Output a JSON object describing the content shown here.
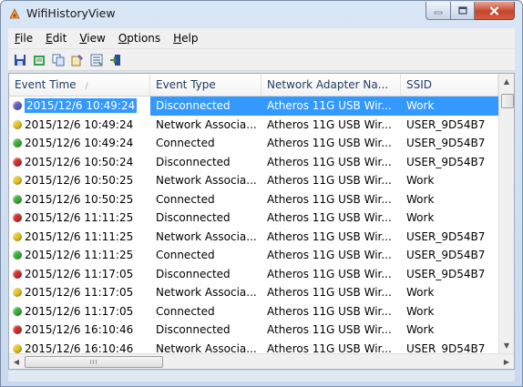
{
  "window": {
    "title": "WifiHistoryView"
  },
  "menu": [
    {
      "label": "File",
      "u": "F",
      "rest": "ile"
    },
    {
      "label": "Edit",
      "u": "E",
      "rest": "dit"
    },
    {
      "label": "View",
      "u": "V",
      "rest": "iew"
    },
    {
      "label": "Options",
      "u": "O",
      "rest": "ptions"
    },
    {
      "label": "Help",
      "u": "H",
      "rest": "elp"
    }
  ],
  "toolbar": {
    "icons": [
      "save-icon",
      "html-report-icon",
      "copy-icon",
      "properties-icon",
      "options-icon",
      "exit-icon"
    ]
  },
  "columns": [
    "Event Time",
    "Event Type",
    "Network Adapter Na...",
    "SSID"
  ],
  "rows": [
    {
      "status": "blue",
      "time": "2015/12/6 10:49:24",
      "type": "Disconnected",
      "adapter": "Atheros 11G USB Wir...",
      "ssid": "Work"
    },
    {
      "status": "yellow",
      "time": "2015/12/6 10:49:24",
      "type": "Network Associa...",
      "adapter": "Atheros 11G USB Wir...",
      "ssid": "USER_9D54B7"
    },
    {
      "status": "green",
      "time": "2015/12/6 10:49:24",
      "type": "Connected",
      "adapter": "Atheros 11G USB Wir...",
      "ssid": "USER_9D54B7"
    },
    {
      "status": "red",
      "time": "2015/12/6 10:50:24",
      "type": "Disconnected",
      "adapter": "Atheros 11G USB Wir...",
      "ssid": "USER_9D54B7"
    },
    {
      "status": "yellow",
      "time": "2015/12/6 10:50:25",
      "type": "Network Associa...",
      "adapter": "Atheros 11G USB Wir...",
      "ssid": "Work"
    },
    {
      "status": "green",
      "time": "2015/12/6 10:50:25",
      "type": "Connected",
      "adapter": "Atheros 11G USB Wir...",
      "ssid": "Work"
    },
    {
      "status": "red",
      "time": "2015/12/6 11:11:25",
      "type": "Disconnected",
      "adapter": "Atheros 11G USB Wir...",
      "ssid": "Work"
    },
    {
      "status": "yellow",
      "time": "2015/12/6 11:11:25",
      "type": "Network Associa...",
      "adapter": "Atheros 11G USB Wir...",
      "ssid": "USER_9D54B7"
    },
    {
      "status": "green",
      "time": "2015/12/6 11:11:25",
      "type": "Connected",
      "adapter": "Atheros 11G USB Wir...",
      "ssid": "USER_9D54B7"
    },
    {
      "status": "red",
      "time": "2015/12/6 11:17:05",
      "type": "Disconnected",
      "adapter": "Atheros 11G USB Wir...",
      "ssid": "USER_9D54B7"
    },
    {
      "status": "yellow",
      "time": "2015/12/6 11:17:05",
      "type": "Network Associa...",
      "adapter": "Atheros 11G USB Wir...",
      "ssid": "Work"
    },
    {
      "status": "green",
      "time": "2015/12/6 11:17:05",
      "type": "Connected",
      "adapter": "Atheros 11G USB Wir...",
      "ssid": "Work"
    },
    {
      "status": "red",
      "time": "2015/12/6 16:10:46",
      "type": "Disconnected",
      "adapter": "Atheros 11G USB Wir...",
      "ssid": "Work"
    },
    {
      "status": "yellow",
      "time": "2015/12/6 16:10:46",
      "type": "Network Associa...",
      "adapter": "Atheros 11G USB Wir...",
      "ssid": "USER_9D54B7"
    }
  ],
  "selected_row": 0,
  "colors": {
    "selection": "#3399ff",
    "close_button": "#c7452c"
  },
  "scrollbar": {
    "h_thumb_grip": "III"
  }
}
